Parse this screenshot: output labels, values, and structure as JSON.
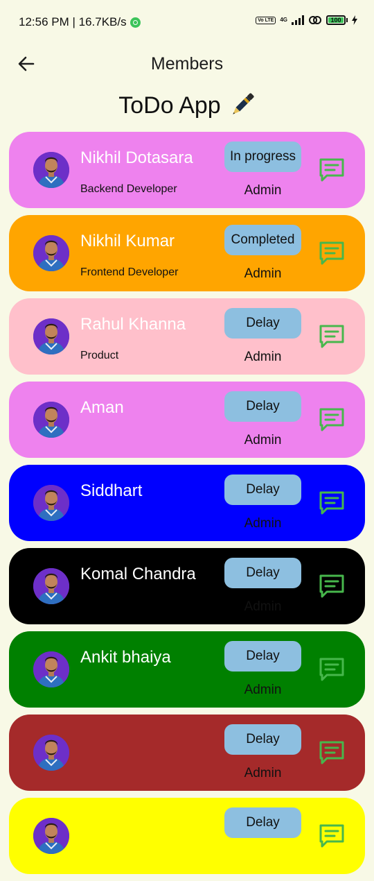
{
  "status_bar": {
    "time_speed": "12:56 PM | 16.7KB/s",
    "volte": "Vo LTE",
    "network": "4G",
    "battery": "100"
  },
  "app_bar": {
    "title": "Members"
  },
  "app_title": "ToDo App",
  "colors": {
    "background": "#f8f9e6",
    "status_badge": "#8dbfe0",
    "chat_icon": "#47b74c"
  },
  "members": [
    {
      "name": "Nikhil Dotasara",
      "role": "Backend Developer",
      "status": "In progress",
      "access": "Admin",
      "color": "#ee82ee"
    },
    {
      "name": "Nikhil Kumar",
      "role": "Frontend Developer",
      "status": "Completed",
      "access": "Admin",
      "color": "#ffa500"
    },
    {
      "name": "Rahul Khanna",
      "role": "Product",
      "status": "Delay",
      "access": "Admin",
      "color": "#ffc0cb"
    },
    {
      "name": "Aman",
      "role": "",
      "status": "Delay",
      "access": "Admin",
      "color": "#ee82ee"
    },
    {
      "name": "Siddhart",
      "role": "",
      "status": "Delay",
      "access": "Admin",
      "color": "#0000ff"
    },
    {
      "name": "Komal Chandra",
      "role": "",
      "status": "Delay",
      "access": "Admin",
      "color": "#000000"
    },
    {
      "name": "Ankit bhaiya",
      "role": "",
      "status": "Delay",
      "access": "Admin",
      "color": "#008000"
    },
    {
      "name": "",
      "role": "",
      "status": "Delay",
      "access": "Admin",
      "color": "#a52a2a"
    },
    {
      "name": "",
      "role": "",
      "status": "Delay",
      "access": "",
      "color": "#ffff00"
    }
  ]
}
